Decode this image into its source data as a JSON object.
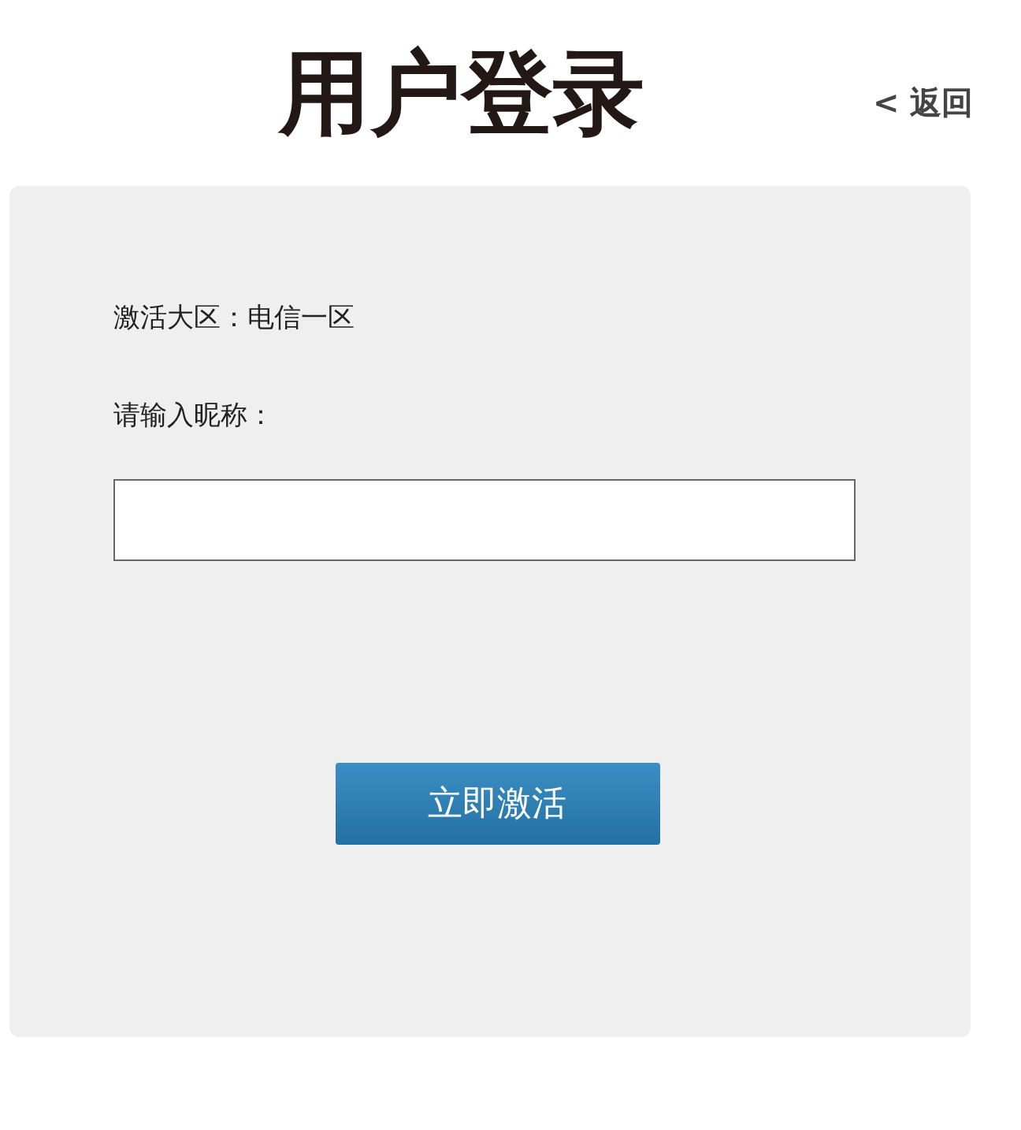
{
  "title": "用户登录",
  "back_link": "< 返回",
  "form": {
    "region": "激活大区：电信一区",
    "nickname_label": "请输入昵称：",
    "submit_button": "立即激活"
  }
}
